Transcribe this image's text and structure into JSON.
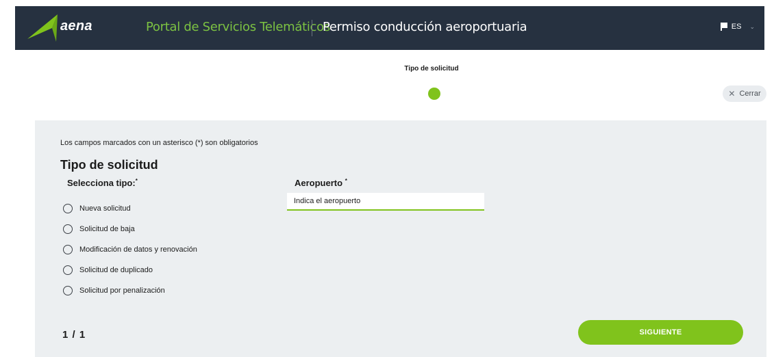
{
  "header": {
    "brand": "aena",
    "portal_title": "Portal de Servicios Telemáticos",
    "procedure_title": "Permiso conducción aeroportuaria",
    "language": "ES",
    "brand_color": "#80c31c",
    "background_color": "#263140"
  },
  "stepper": {
    "step_label": "Tipo de solicitud",
    "active_color": "#80c31c"
  },
  "close_button": {
    "label": "Cerrar",
    "icon": "close-icon"
  },
  "form": {
    "required_note": "Los campos marcados con un asterisco (*) son obligatorios",
    "section_title": "Tipo de solicitud",
    "select_label": "Selecciona tipo:",
    "asterisk": "*",
    "options": [
      "Nueva solicitud",
      "Solicitud de baja",
      "Modificación de datos y renovación",
      "Solicitud de duplicado",
      "Solicitud por penalización"
    ],
    "airport_label": "Aeropuerto",
    "airport_placeholder": "Indica el aeropuerto"
  },
  "footer": {
    "pager": "1 / 1",
    "next_label": "SIGUIENTE"
  }
}
